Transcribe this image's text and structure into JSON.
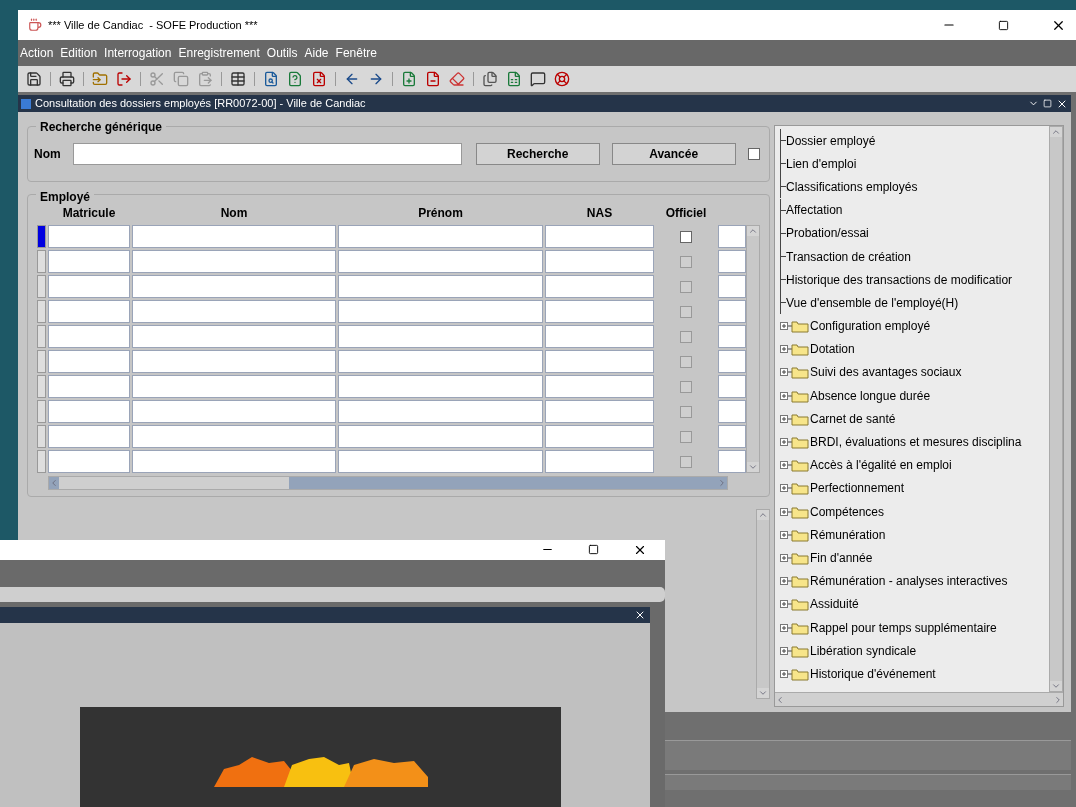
{
  "window": {
    "title": "*** Ville de Candiac  - SOFE Production ***"
  },
  "menu": [
    {
      "label": "Action"
    },
    {
      "label": "Edition"
    },
    {
      "label": "Interrogation"
    },
    {
      "label": "Enregistrement"
    },
    {
      "label": "Outils"
    },
    {
      "label": "Aide"
    },
    {
      "label": "Fenêtre"
    }
  ],
  "form_window": {
    "title": "Consultation des dossiers employés [RR0072-00] - Ville de Candiac"
  },
  "search_group": {
    "title": "Recherche générique",
    "name_label": "Nom",
    "search_button": "Recherche",
    "advanced_button": "Avancée",
    "advanced_checked": false
  },
  "employee_block": {
    "title": "Employé",
    "columns": [
      "Matricule",
      "Nom",
      "Prénom",
      "NAS",
      "Officiel"
    ],
    "rows": [
      {
        "current": true,
        "disabled": false,
        "official_checked": false
      },
      {
        "current": false,
        "disabled": true,
        "official_checked": false
      },
      {
        "current": false,
        "disabled": true,
        "official_checked": false
      },
      {
        "current": false,
        "disabled": true,
        "official_checked": false
      },
      {
        "current": false,
        "disabled": true,
        "official_checked": false
      },
      {
        "current": false,
        "disabled": true,
        "official_checked": false
      },
      {
        "current": false,
        "disabled": true,
        "official_checked": false
      },
      {
        "current": false,
        "disabled": true,
        "official_checked": false
      },
      {
        "current": false,
        "disabled": true,
        "official_checked": false
      },
      {
        "current": false,
        "disabled": true,
        "official_checked": false
      }
    ]
  },
  "tree": {
    "items": [
      {
        "label": "Dossier employé",
        "kind": "leaf"
      },
      {
        "label": "Lien d'emploi",
        "kind": "leaf"
      },
      {
        "label": "Classifications employés",
        "kind": "leaf"
      },
      {
        "label": "Affectation",
        "kind": "leaf"
      },
      {
        "label": "Probation/essai",
        "kind": "leaf"
      },
      {
        "label": "Transaction de création",
        "kind": "leaf"
      },
      {
        "label": "Historique des transactions de modificatior",
        "kind": "leaf"
      },
      {
        "label": "Vue d'ensemble de l'employé(H)",
        "kind": "leaf"
      },
      {
        "label": "Configuration employé",
        "kind": "folder"
      },
      {
        "label": "Dotation",
        "kind": "folder"
      },
      {
        "label": "Suivi des avantages sociaux",
        "kind": "folder"
      },
      {
        "label": "Absence longue durée",
        "kind": "folder"
      },
      {
        "label": "Carnet de santé",
        "kind": "folder"
      },
      {
        "label": "BRDI, évaluations et mesures disciplina",
        "kind": "folder"
      },
      {
        "label": "Accès à l'égalité en emploi",
        "kind": "folder"
      },
      {
        "label": "Perfectionnement",
        "kind": "folder"
      },
      {
        "label": "Compétences",
        "kind": "folder"
      },
      {
        "label": "Rémunération",
        "kind": "folder"
      },
      {
        "label": "Fin d'année",
        "kind": "folder"
      },
      {
        "label": "Rémunération - analyses interactives",
        "kind": "folder"
      },
      {
        "label": "Assiduité",
        "kind": "folder"
      },
      {
        "label": "Rappel pour temps supplémentaire",
        "kind": "folder"
      },
      {
        "label": "Libération syndicale",
        "kind": "folder"
      },
      {
        "label": "Historique d'événement",
        "kind": "folder"
      }
    ]
  }
}
